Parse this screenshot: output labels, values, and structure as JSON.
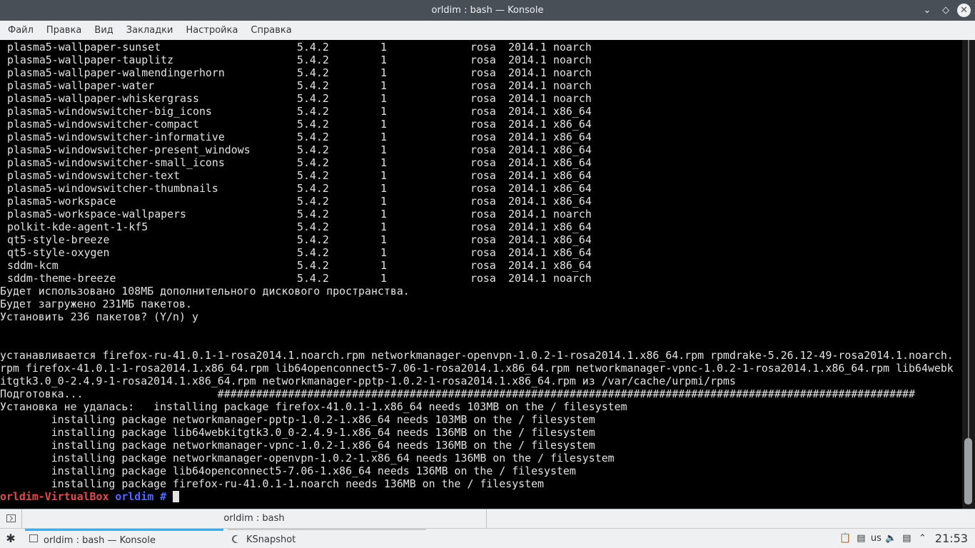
{
  "window": {
    "title": "orldim : bash — Konsole"
  },
  "menu": [
    "Файл",
    "Правка",
    "Вид",
    "Закладки",
    "Настройка",
    "Справка"
  ],
  "packages": [
    {
      "name": "plasma5-wallpaper-sunset",
      "version": "5.4.2",
      "release": "1",
      "repo": "rosa",
      "dist": "2014.1",
      "arch": "noarch"
    },
    {
      "name": "plasma5-wallpaper-tauplitz",
      "version": "5.4.2",
      "release": "1",
      "repo": "rosa",
      "dist": "2014.1",
      "arch": "noarch"
    },
    {
      "name": "plasma5-wallpaper-walmendingerhorn",
      "version": "5.4.2",
      "release": "1",
      "repo": "rosa",
      "dist": "2014.1",
      "arch": "noarch"
    },
    {
      "name": "plasma5-wallpaper-water",
      "version": "5.4.2",
      "release": "1",
      "repo": "rosa",
      "dist": "2014.1",
      "arch": "noarch"
    },
    {
      "name": "plasma5-wallpaper-whiskergrass",
      "version": "5.4.2",
      "release": "1",
      "repo": "rosa",
      "dist": "2014.1",
      "arch": "noarch"
    },
    {
      "name": "plasma5-windowswitcher-big_icons",
      "version": "5.4.2",
      "release": "1",
      "repo": "rosa",
      "dist": "2014.1",
      "arch": "x86_64"
    },
    {
      "name": "plasma5-windowswitcher-compact",
      "version": "5.4.2",
      "release": "1",
      "repo": "rosa",
      "dist": "2014.1",
      "arch": "x86_64"
    },
    {
      "name": "plasma5-windowswitcher-informative",
      "version": "5.4.2",
      "release": "1",
      "repo": "rosa",
      "dist": "2014.1",
      "arch": "x86_64"
    },
    {
      "name": "plasma5-windowswitcher-present_windows",
      "version": "5.4.2",
      "release": "1",
      "repo": "rosa",
      "dist": "2014.1",
      "arch": "x86_64"
    },
    {
      "name": "plasma5-windowswitcher-small_icons",
      "version": "5.4.2",
      "release": "1",
      "repo": "rosa",
      "dist": "2014.1",
      "arch": "x86_64"
    },
    {
      "name": "plasma5-windowswitcher-text",
      "version": "5.4.2",
      "release": "1",
      "repo": "rosa",
      "dist": "2014.1",
      "arch": "x86_64"
    },
    {
      "name": "plasma5-windowswitcher-thumbnails",
      "version": "5.4.2",
      "release": "1",
      "repo": "rosa",
      "dist": "2014.1",
      "arch": "x86_64"
    },
    {
      "name": "plasma5-workspace",
      "version": "5.4.2",
      "release": "1",
      "repo": "rosa",
      "dist": "2014.1",
      "arch": "x86_64"
    },
    {
      "name": "plasma5-workspace-wallpapers",
      "version": "5.4.2",
      "release": "1",
      "repo": "rosa",
      "dist": "2014.1",
      "arch": "noarch"
    },
    {
      "name": "polkit-kde-agent-1-kf5",
      "version": "5.4.2",
      "release": "1",
      "repo": "rosa",
      "dist": "2014.1",
      "arch": "x86_64"
    },
    {
      "name": "qt5-style-breeze",
      "version": "5.4.2",
      "release": "1",
      "repo": "rosa",
      "dist": "2014.1",
      "arch": "x86_64"
    },
    {
      "name": "qt5-style-oxygen",
      "version": "5.4.2",
      "release": "1",
      "repo": "rosa",
      "dist": "2014.1",
      "arch": "x86_64"
    },
    {
      "name": "sddm-kcm",
      "version": "5.4.2",
      "release": "1",
      "repo": "rosa",
      "dist": "2014.1",
      "arch": "x86_64"
    },
    {
      "name": "sddm-theme-breeze",
      "version": "5.4.2",
      "release": "1",
      "repo": "rosa",
      "dist": "2014.1",
      "arch": "noarch"
    }
  ],
  "output_lines": [
    "Будет использовано 108МБ дополнительного дискового пространства.",
    "Будет загружено 231МБ пакетов.",
    "Установить 236 пакетов? (Y/n) y",
    "",
    "",
    "устанавливается firefox-ru-41.0.1-1-rosa2014.1.noarch.rpm networkmanager-openvpn-1.0.2-1-rosa2014.1.x86_64.rpm rpmdrake-5.26.12-49-rosa2014.1.noarch.",
    "rpm firefox-41.0.1-1-rosa2014.1.x86_64.rpm lib64openconnect5-7.06-1-rosa2014.1.x86_64.rpm networkmanager-vpnc-1.0.2-1-rosa2014.1.x86_64.rpm lib64webk",
    "itgtk3.0_0-2.4.9-1-rosa2014.1.x86_64.rpm networkmanager-pptp-1.0.2-1-rosa2014.1.x86_64.rpm из /var/cache/urpmi/rpms",
    "Подготовка...                     #############################################################################################################",
    "Установка не удалась:   installing package firefox-41.0.1-1.x86_64 needs 103MB on the / filesystem",
    "        installing package networkmanager-pptp-1.0.2-1.x86_64 needs 103MB on the / filesystem",
    "        installing package lib64webkitgtk3.0_0-2.4.9-1.x86_64 needs 136MB on the / filesystem",
    "        installing package networkmanager-vpnc-1.0.2-1.x86_64 needs 136MB on the / filesystem",
    "        installing package networkmanager-openvpn-1.0.2-1.x86_64 needs 136MB on the / filesystem",
    "        installing package lib64openconnect5-7.06-1.x86_64 needs 136MB on the / filesystem",
    "        installing package firefox-ru-41.0.1-1.noarch needs 136MB on the / filesystem"
  ],
  "prompt": {
    "host": "orldim-VirtualBox",
    "dir": "orldim",
    "symbol": "#"
  },
  "tab": {
    "label": "orldim : bash"
  },
  "taskbar": {
    "tasks": [
      {
        "label": "orldim : bash — Konsole",
        "active": true
      },
      {
        "label": "KSnapshot",
        "active": false
      }
    ],
    "keyboard_layout": "us",
    "clock": "21:53"
  },
  "colors": {
    "titlebar": "#475057",
    "panel": "#eff0f1",
    "accent": "#3daee9",
    "prompt_host": "#e24c4c",
    "prompt_dir": "#4f6bff"
  }
}
